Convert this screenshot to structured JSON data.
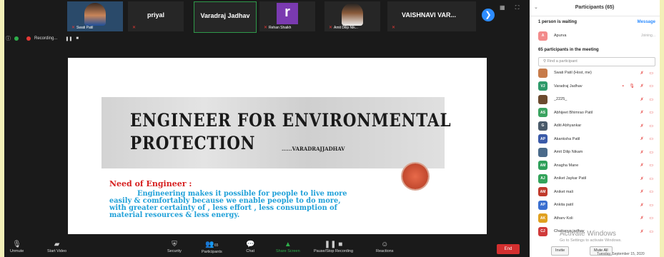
{
  "top_strip": {
    "tiles": [
      {
        "name": "",
        "caption": "Swati Patil"
      },
      {
        "name": "priyal",
        "caption": ""
      },
      {
        "name": "Varadraj Jadhav",
        "caption": ""
      },
      {
        "name": "r",
        "caption": "Rehan Shaikh"
      },
      {
        "name": "",
        "caption": "Amit Dilip Nik..."
      },
      {
        "name": "VAISHNAVI VAR...",
        "caption": ""
      }
    ],
    "recording_label": "Recording..."
  },
  "slide": {
    "title_line1": "ENGINEER FOR ENVIRONMENTAL",
    "title_line2": "PROTECTION",
    "byline": "......VARADRAJJADHAV",
    "need_heading": "Need of Engineer :",
    "body_lines": [
      "Engineering makes it possible for people to live more",
      "easily & comfortably because we enable people to do more,",
      "with greater certainty of , less effort , less consumption of",
      "material resources & less energy."
    ]
  },
  "toolbar": {
    "unmute": "Unmute",
    "start_video": "Start Video",
    "security": "Security",
    "participants": "Participants",
    "participants_count": "65",
    "chat": "Chat",
    "share_screen": "Share Screen",
    "pause_recording": "Pause/Stop Recording",
    "reactions": "Reactions",
    "end": "End"
  },
  "panel": {
    "title": "Participants (65)",
    "waiting_text": "1 person is waiting",
    "message_label": "Message",
    "waiting_person": {
      "name": "Apurva",
      "status": "Joining...",
      "initial": "A",
      "color": "#f28b8b"
    },
    "count_text": "65 participants in the meeting",
    "search_placeholder": "Find a participant",
    "participants": [
      {
        "initials": "",
        "name": "Swati Patil (Host, me)",
        "color": "#c77b4a"
      },
      {
        "initials": "VJ",
        "name": "Varadraj Jadhav",
        "color": "#2e9a6a"
      },
      {
        "initials": "",
        "name": "_2225_",
        "color": "#6b4a2e"
      },
      {
        "initials": "AS",
        "name": "Abhijeet Bhimrao Patil",
        "color": "#3aa360"
      },
      {
        "initials": "G",
        "name": "Aditi Abhyankar",
        "color": "#4a5a6a"
      },
      {
        "initials": "AP",
        "name": "Akanksha Patil",
        "color": "#3a5aa8"
      },
      {
        "initials": "",
        "name": "Amit Dilip Nikam",
        "color": "#4a6a8a"
      },
      {
        "initials": "AM",
        "name": "Anagha Mane",
        "color": "#2ea05a"
      },
      {
        "initials": "AJ",
        "name": "Aniket Jaykar Patil",
        "color": "#33a35a"
      },
      {
        "initials": "AM",
        "name": "Aniket mali",
        "color": "#c0392b"
      },
      {
        "initials": "AP",
        "name": "Ankita patil",
        "color": "#3a6fd0"
      },
      {
        "initials": "AK",
        "name": "Atharv Koli",
        "color": "#e0a020"
      },
      {
        "initials": "CJ",
        "name": "Chaitanya jadhav",
        "color": "#d03a3a"
      }
    ],
    "watermark": "Activate Windows",
    "watermark_sub": "Go to Settings to activate Windows.",
    "invite": "Invite",
    "mute_all": "Mute All",
    "date": "Tuesday, September 15, 2020"
  }
}
